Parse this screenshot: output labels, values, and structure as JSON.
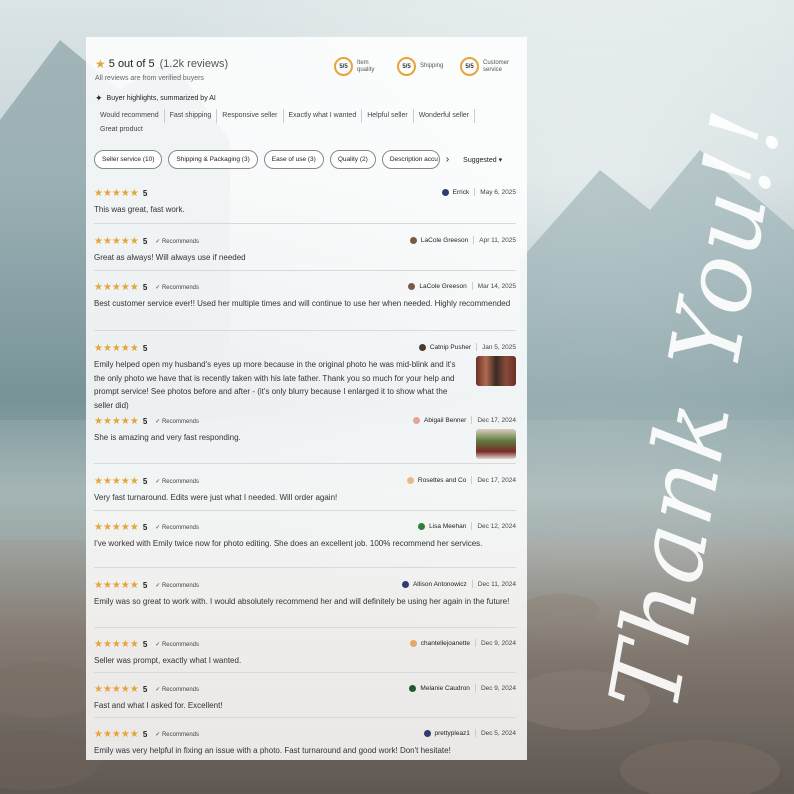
{
  "summary": {
    "rating": "5 out of 5",
    "count": "(1.2k reviews)",
    "verified": "All reviews are from verified buyers",
    "metrics": [
      {
        "score": "5/5",
        "label": "Item quality"
      },
      {
        "score": "5/5",
        "label": "Shipping"
      },
      {
        "score": "5/5",
        "label": "Customer service"
      }
    ]
  },
  "ai_highlights": {
    "title": "Buyer highlights, summarized by AI",
    "tags": [
      "Would recommend",
      "Fast shipping",
      "Responsive seller",
      "Exactly what I wanted",
      "Helpful seller",
      "Wonderful seller",
      "Great product"
    ]
  },
  "filters": [
    "Seller service (10)",
    "Shipping & Packaging (3)",
    "Ease of use (3)",
    "Quality (2)",
    "Description accu"
  ],
  "sort_label": "Suggested",
  "reviews": [
    {
      "stars": "★★★★★",
      "score": "5",
      "recommends": "",
      "author": "Errick",
      "date": "May 6, 2025",
      "text": "This was great, fast work."
    },
    {
      "stars": "★★★★★",
      "score": "5",
      "recommends": "✓ Recommends",
      "author": "LaCole Greeson",
      "date": "Apr 11, 2025",
      "text": "Great as always! Will always use if needed"
    },
    {
      "stars": "★★★★★",
      "score": "5",
      "recommends": "✓ Recommends",
      "author": "LaCole Greeson",
      "date": "Mar 14, 2025",
      "text": "Best customer service ever!! Used her multiple times and will continue to use her when needed. Highly recommended"
    },
    {
      "stars": "★★★★★",
      "score": "5",
      "recommends": "",
      "author": "Catnip Pusher",
      "date": "Jan 5, 2025",
      "text": "Emily helped open my husband's eyes up more because in the original photo he was mid-blink and it's the only photo we have that is recently taken with his late father. Thank you so much for your help and prompt service! See photos before and after - (it's only blurry because I enlarged it to show what the seller did)"
    },
    {
      "stars": "★★★★★",
      "score": "5",
      "recommends": "✓ Recommends",
      "author": "Abigail Benner",
      "date": "Dec 17, 2024",
      "text": "She is amazing and very fast responding."
    },
    {
      "stars": "★★★★★",
      "score": "5",
      "recommends": "✓ Recommends",
      "author": "Rosettes and Co",
      "date": "Dec 17, 2024",
      "text": "Very fast turnaround. Edits were just what I needed. Will order again!"
    },
    {
      "stars": "★★★★★",
      "score": "5",
      "recommends": "✓ Recommends",
      "author": "Lisa Meehan",
      "date": "Dec 12, 2024",
      "text": "I've worked with Emily twice now for photo editing. She does an excellent job. 100% recommend her services."
    },
    {
      "stars": "★★★★★",
      "score": "5",
      "recommends": "✓ Recommends",
      "author": "Allison Antonowicz",
      "date": "Dec 11, 2024",
      "text": "Emily was so great to work with. I would absolutely recommend her and will definitely be using her again in the future!"
    },
    {
      "stars": "★★★★★",
      "score": "5",
      "recommends": "✓ Recommends",
      "author": "chantellejoanette",
      "date": "Dec 9, 2024",
      "text": "Seller was prompt, exactly what I wanted."
    },
    {
      "stars": "★★★★★",
      "score": "5",
      "recommends": "✓ Recommends",
      "author": "Melanie Caudron",
      "date": "Dec 9, 2024",
      "text": "Fast and what I asked for. Excellent!"
    },
    {
      "stars": "★★★★★",
      "score": "5",
      "recommends": "✓ Recommends",
      "author": "prettypleaz1",
      "date": "Dec 5, 2024",
      "text": "Emily was very helpful in fixing an issue with a photo. Fast turnaround and good work! Don't hesitate!"
    }
  ],
  "overlay_text": "Thank You!!",
  "colors": {
    "star": "#e8a33a",
    "panel": "#ffffff",
    "text": "#222222"
  }
}
